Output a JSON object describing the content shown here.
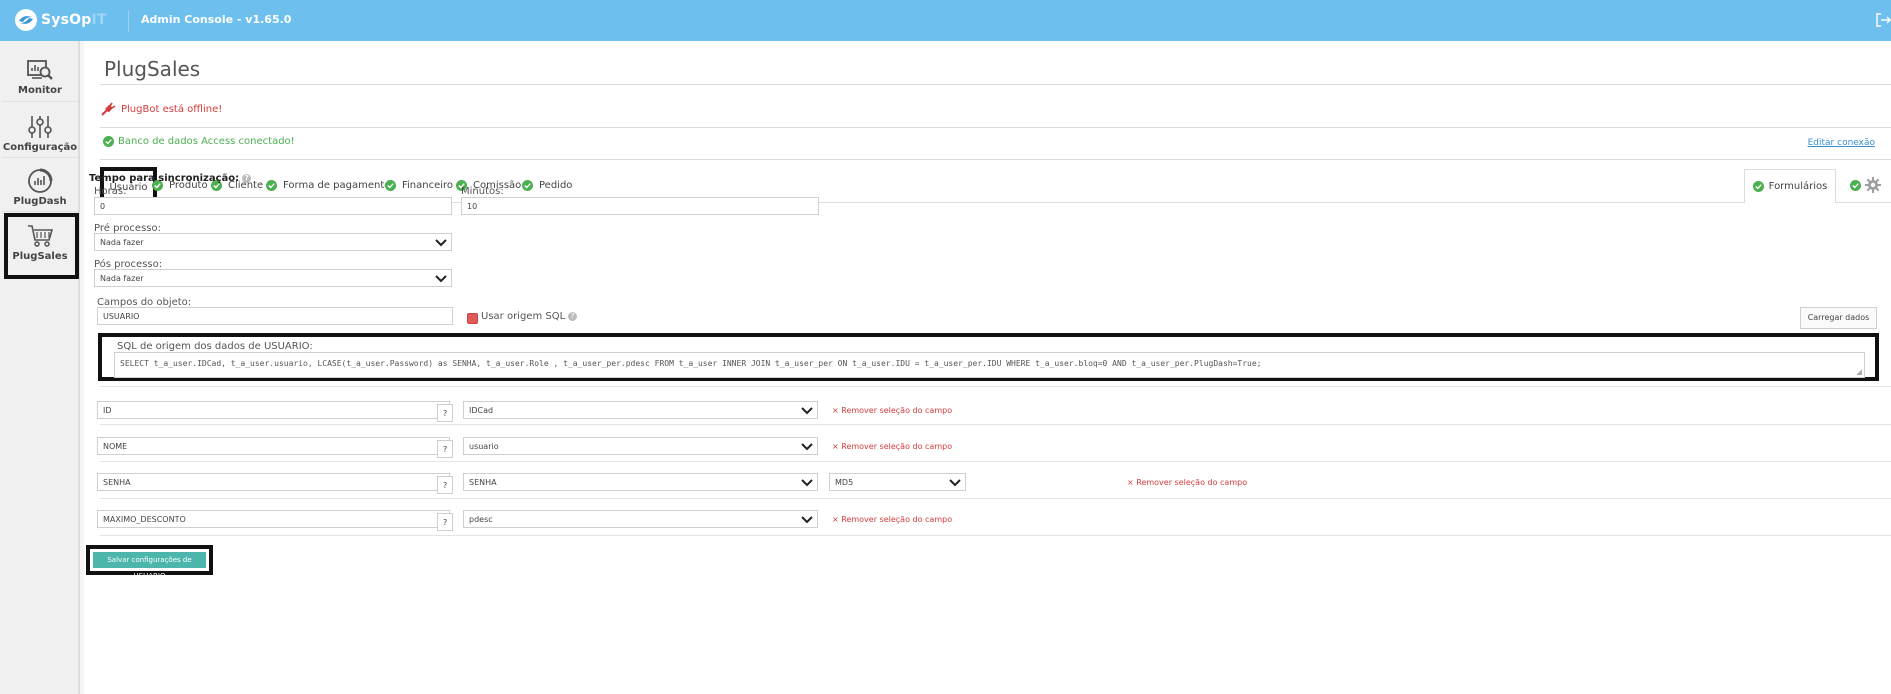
{
  "topbar": {
    "logo_text": "SysOp",
    "logo_suffix": "IT",
    "title": "Admin Console - v1.65.0"
  },
  "sidebar": {
    "items": [
      {
        "label": "Monitor",
        "icon": "monitor-search-icon"
      },
      {
        "label": "Configuração",
        "icon": "sliders-icon"
      },
      {
        "label": "PlugDash",
        "icon": "gauge-icon"
      },
      {
        "label": "PlugSales",
        "icon": "shopping-cart-icon"
      }
    ]
  },
  "page": {
    "title": "PlugSales",
    "alert_offline": "PlugBot está offline!",
    "alert_db": "Banco de dados Access conectado!",
    "edit_connection": "Editar conexão"
  },
  "tabs": {
    "items": [
      "Usuário",
      "Produto",
      "Cliente",
      "Forma de pagamento",
      "Financeiro",
      "Comissão",
      "Pedido"
    ],
    "forms": "Formulários"
  },
  "form": {
    "sync_label": "Tempo para sincronização:",
    "hours_label": "Horas:",
    "hours_value": "0",
    "minutes_label": "Minutos:",
    "minutes_value": "10",
    "pre_label": "Pré processo:",
    "pre_value": "Nada fazer",
    "post_label": "Pós processo:",
    "post_value": "Nada fazer",
    "fields_label": "Campos do objeto:",
    "fields_value": "USUARIO",
    "use_sql_label": "Usar origem SQL",
    "load_button": "Carregar dados",
    "sql_label": "SQL de origem dos dados de USUARIO:",
    "sql_value": "SELECT t_a_user.IDCad, t_a_user.usuario, LCASE(t_a_user.Password) as SENHA, t_a_user.Role , t_a_user_per.pdesc FROM t_a_user INNER JOIN t_a_user_per ON t_a_user.IDU = t_a_user_per.IDU WHERE t_a_user.bloq=0 AND t_a_user_per.PlugDash=True;"
  },
  "mappings": [
    {
      "field": "ID",
      "source": "IDCad",
      "remove": "× Remover seleção do campo"
    },
    {
      "field": "NOME",
      "source": "usuario",
      "remove": "× Remover seleção do campo"
    },
    {
      "field": "SENHA",
      "source": "SENHA",
      "hash": "MD5",
      "remove": "× Remover seleção do campo"
    },
    {
      "field": "MAXIMO_DESCONTO",
      "source": "pdesc",
      "remove": "× Remover seleção do campo"
    }
  ],
  "save_button": "Salvar configurações de USUARIO",
  "colors": {
    "topbar": "#6dbfee",
    "success": "#4caf50",
    "danger": "#d43b3b",
    "save_button": "#4db6ac"
  }
}
